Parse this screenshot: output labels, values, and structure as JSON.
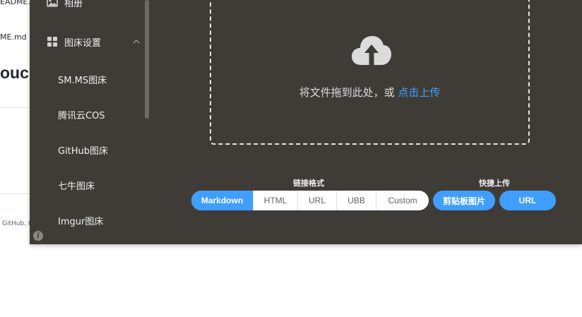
{
  "background_page": {
    "line1": "EADME.",
    "line2": "ME.md",
    "heading": "ouc",
    "footer": "GitHub, I"
  },
  "sidebar": {
    "album_label": "相册",
    "settings_label": "图床设置",
    "sub_items": [
      "SM.MS图床",
      "腾讯云COS",
      "GitHub图床",
      "七牛图床",
      "Imgur图床"
    ],
    "info_icon_text": "i"
  },
  "dropzone": {
    "text": "将文件拖到此处，或",
    "link": "点击上传"
  },
  "link_format": {
    "label": "链接格式",
    "options": [
      "Markdown",
      "HTML",
      "URL",
      "UBB",
      "Custom"
    ],
    "selected": "Markdown"
  },
  "quick_upload": {
    "label": "快捷上传",
    "clipboard_button": "剪贴板图片",
    "url_button": "URL"
  },
  "colors": {
    "accent": "#409eff",
    "window_bg": "#3f3c37"
  }
}
